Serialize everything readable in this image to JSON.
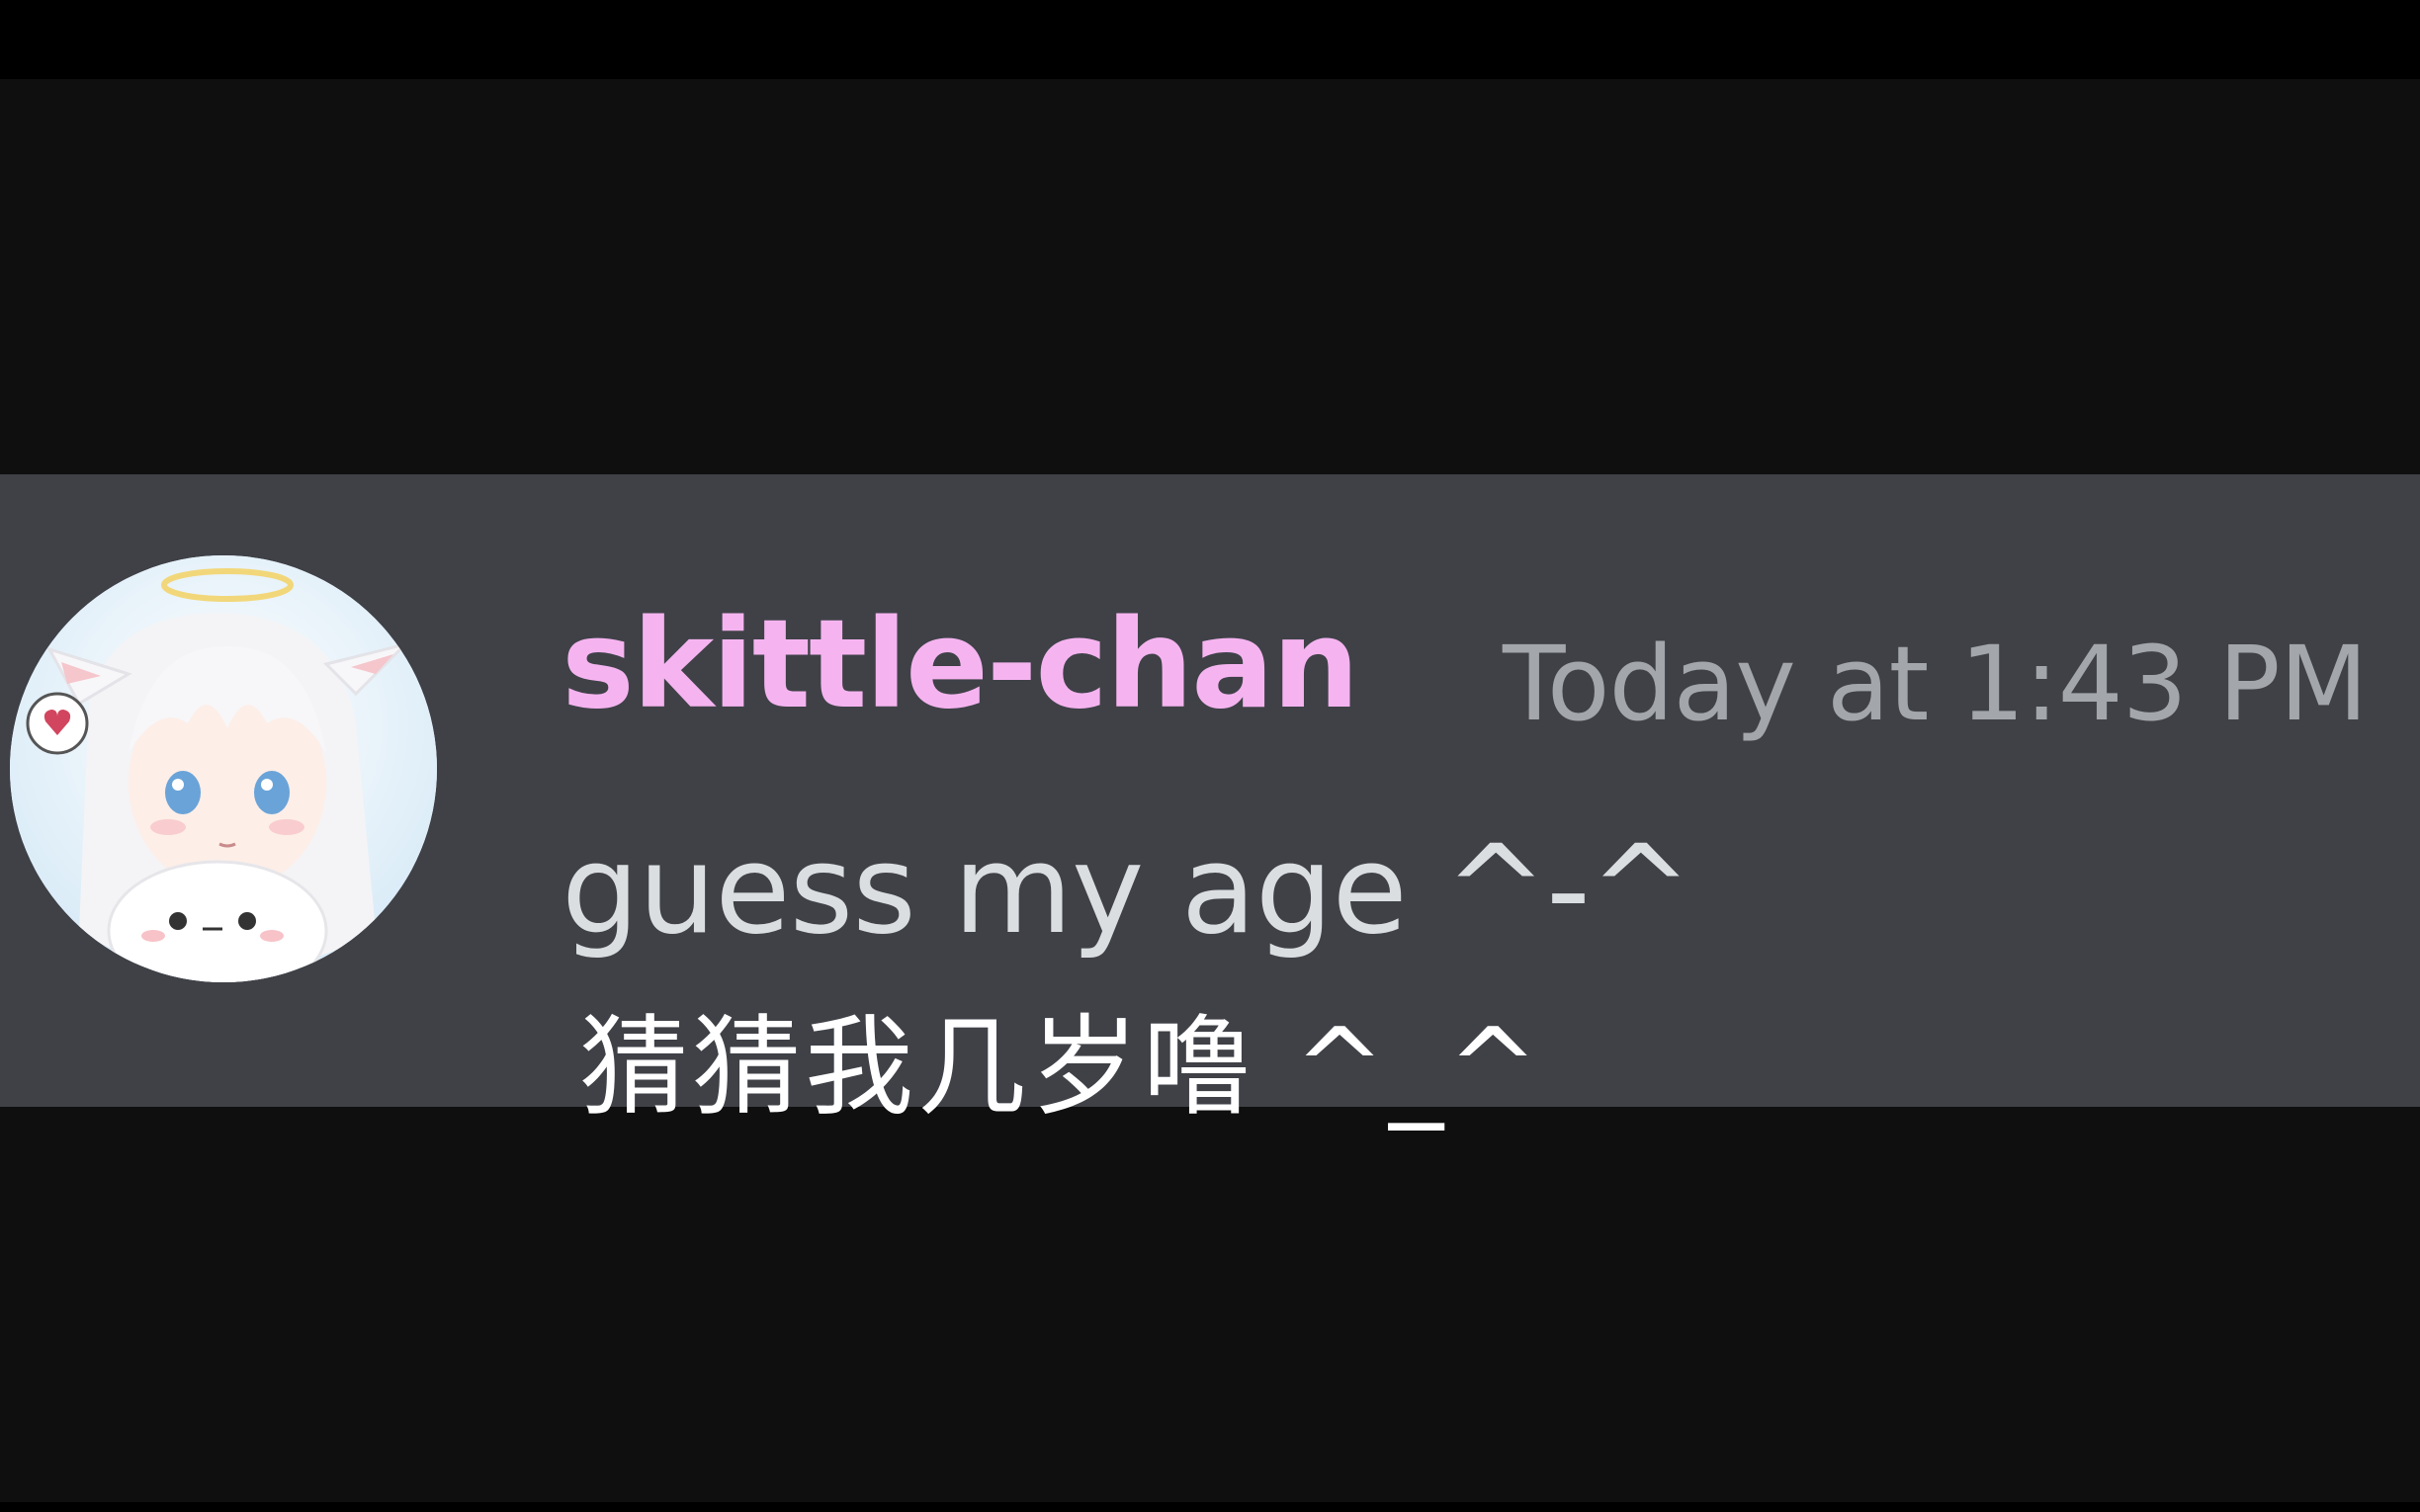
{
  "message": {
    "username": "skittle-chan",
    "timestamp": "Today at 1:43 PM",
    "text": "guess my age ^-^"
  },
  "subtitle": {
    "text": "猜猜我几岁噜 ^_^"
  },
  "colors": {
    "username": "#f5b4f0",
    "timestamp": "#a3a6aa",
    "message_text": "#dbdee1",
    "message_background": "#3f4147",
    "letterbox": "#0f0f10"
  },
  "icons": {
    "avatar": "anime-girl-avatar-with-halo"
  }
}
